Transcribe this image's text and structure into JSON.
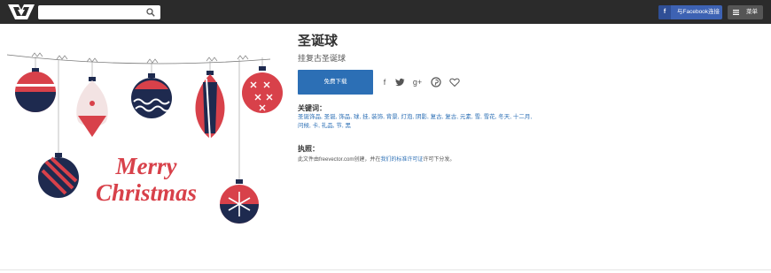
{
  "header": {
    "logo_name": "freevector-logo",
    "search_placeholder": "",
    "facebook_label": "与Facebook连接",
    "facebook_icon": "f",
    "menu_label": "菜单"
  },
  "vector": {
    "title": "圣诞球",
    "subtitle": "挂复古圣诞球",
    "download_label": "免费下载",
    "illustration_text_1": "Merry",
    "illustration_text_2": "Christmas"
  },
  "share_icons": [
    "facebook-icon",
    "twitter-icon",
    "google-plus-icon",
    "pinterest-icon",
    "heart-icon"
  ],
  "keywords": {
    "label": "关键词：",
    "items": [
      "圣诞饰品",
      "圣诞",
      "饰品",
      "球",
      "挂",
      "装饰",
      "背景",
      "灯泡",
      "阴影",
      "复古",
      "复古",
      "元素",
      "雪",
      "雪花",
      "冬天",
      "十二月",
      "问候",
      "卡",
      "礼品",
      "节",
      "黑"
    ]
  },
  "license": {
    "label": "执照：",
    "prefix": "此文件由freevector.com创建，并在",
    "link": "我们的标准许可证",
    "suffix": "许可下分发。"
  },
  "colors": {
    "topbar": "#2b2b2b",
    "accent_blue": "#2c6fb5",
    "facebook_blue": "#3d62b3",
    "ornament_red": "#d8414a",
    "ornament_navy": "#1e2a4f"
  }
}
